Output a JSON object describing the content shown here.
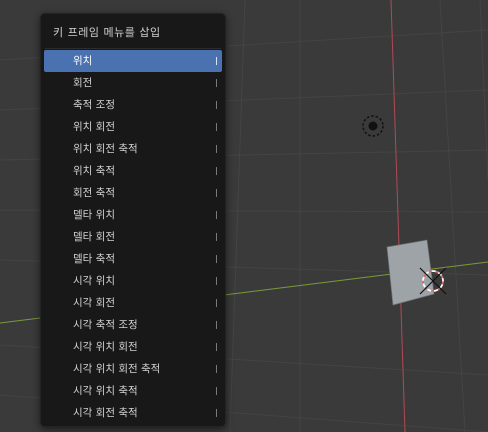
{
  "menu": {
    "title": "키 프레임 메뉴를 삽입",
    "items": [
      {
        "label": "위치",
        "active": true
      },
      {
        "label": "회전"
      },
      {
        "label": "축적 조정"
      },
      {
        "label": "위치 회전"
      },
      {
        "label": "위치 회전 축적"
      },
      {
        "label": "위치 축적"
      },
      {
        "label": "회전 축적"
      },
      {
        "label": "델타 위치"
      },
      {
        "label": "델타 회전"
      },
      {
        "label": "델타 축적"
      },
      {
        "label": "시각 위치"
      },
      {
        "label": "시각 회전"
      },
      {
        "label": "시각 축적 조정"
      },
      {
        "label": "시각 위치 회전"
      },
      {
        "label": "시각 위치 회전 축적"
      },
      {
        "label": "시각 위치 축적"
      },
      {
        "label": "시각 회전 축적"
      }
    ]
  },
  "colors": {
    "viewport_bg": "#3a3a3a",
    "grid": "#434343",
    "x_axis": "#7a9a3a",
    "z_axis": "#b04a55",
    "highlight": "#4a72b0",
    "cube": "#9aa0a4"
  },
  "viewport": {
    "icons": [
      "light-icon",
      "cube-object",
      "origin-cursor-icon"
    ]
  }
}
